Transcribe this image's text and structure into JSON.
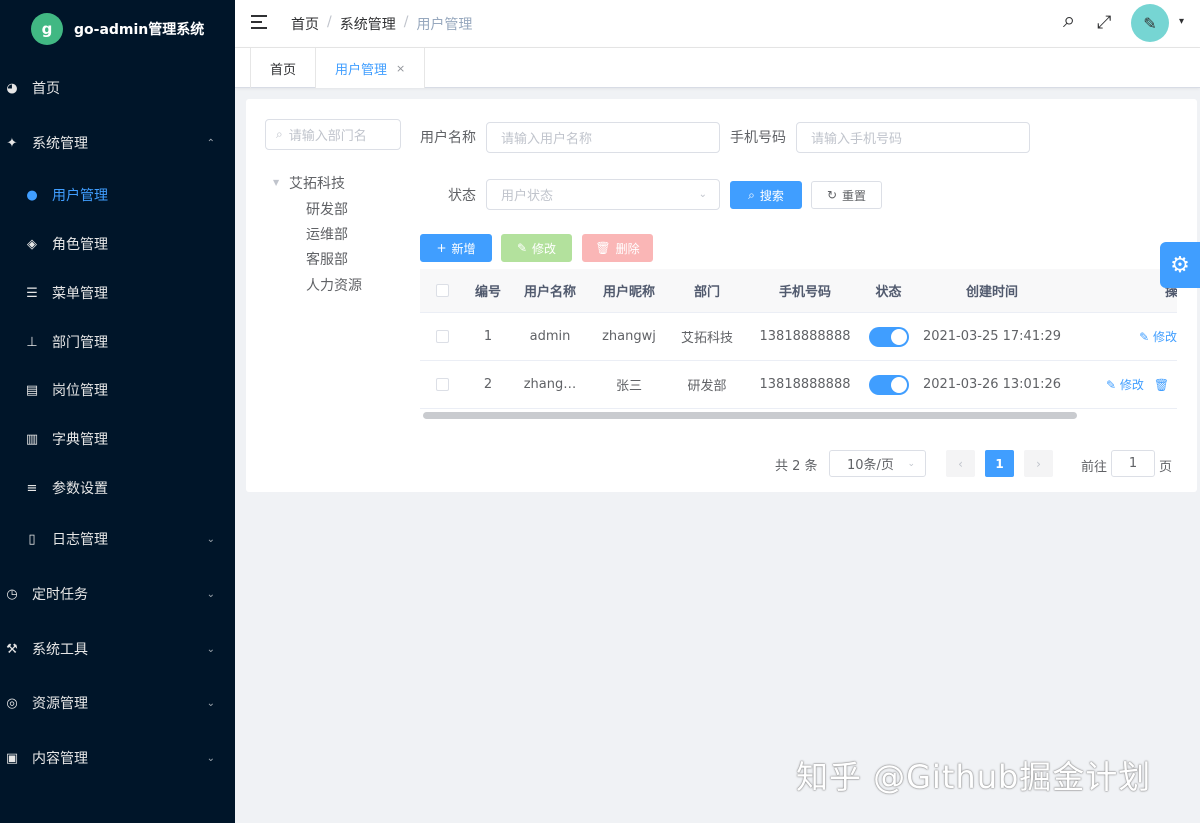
{
  "sidebar": {
    "logo_mark": "g",
    "title": "go-admin管理系统",
    "items": [
      {
        "label": "首页",
        "icon": "◕"
      },
      {
        "label": "系统管理",
        "icon": "✦",
        "arrow": "⌃"
      },
      {
        "label": "用户管理",
        "icon": "●"
      },
      {
        "label": "角色管理",
        "icon": "◈"
      },
      {
        "label": "菜单管理",
        "icon": "☰"
      },
      {
        "label": "部门管理",
        "icon": "⊥"
      },
      {
        "label": "岗位管理",
        "icon": "▤"
      },
      {
        "label": "字典管理",
        "icon": "▥"
      },
      {
        "label": "参数设置",
        "icon": "≡"
      },
      {
        "label": "日志管理",
        "icon": "▯",
        "arrow": "⌄"
      },
      {
        "label": "定时任务",
        "icon": "◷",
        "arrow": "⌄"
      },
      {
        "label": "系统工具",
        "icon": "⚒",
        "arrow": "⌄"
      },
      {
        "label": "资源管理",
        "icon": "◎",
        "arrow": "⌄"
      },
      {
        "label": "内容管理",
        "icon": "▣",
        "arrow": "⌄"
      }
    ]
  },
  "header": {
    "breadcrumb": [
      "首页",
      "系统管理",
      "用户管理"
    ],
    "separator": "/",
    "search_icon": "⌕",
    "fullscreen_icon": "⤢",
    "avatar_glyph": "✎",
    "caret": "▾"
  },
  "tags": {
    "home": "首页",
    "user": "用户管理",
    "close": "×"
  },
  "left": {
    "dept_search_placeholder": "请输入部门名",
    "tree_root": "艾拓科技",
    "tree_children": [
      "研发部",
      "运维部",
      "客服部",
      "人力资源"
    ]
  },
  "form": {
    "username_label": "用户名称",
    "username_placeholder": "请输入用户名称",
    "phone_label": "手机号码",
    "phone_placeholder": "请输入手机号码",
    "status_label": "状态",
    "status_placeholder": "用户状态",
    "search_btn": "搜索",
    "reset_btn": "重置"
  },
  "toolbar": {
    "add": "新增",
    "edit": "修改",
    "delete": "删除"
  },
  "table": {
    "columns": [
      "编号",
      "用户名称",
      "用户昵称",
      "部门",
      "手机号码",
      "状态",
      "创建时间",
      "操"
    ],
    "rows": [
      {
        "id": "1",
        "username": "admin",
        "nickname": "zhangwj",
        "dept": "艾拓科技",
        "phone": "13818888888",
        "created": "2021-03-25 17:41:29",
        "edit": "修改"
      },
      {
        "id": "2",
        "username": "zhang…",
        "nickname": "张三",
        "dept": "研发部",
        "phone": "13818888888",
        "created": "2021-03-26 13:01:26",
        "edit": "修改"
      }
    ]
  },
  "pagination": {
    "total_text": "共 2 条",
    "page_size": "10条/页",
    "prev": "‹",
    "current": "1",
    "next": "›",
    "goto_label": "前往",
    "goto_value": "1",
    "page_unit": "页"
  },
  "settings_icon": "⚙",
  "watermark": "知乎 @Github掘金计划"
}
